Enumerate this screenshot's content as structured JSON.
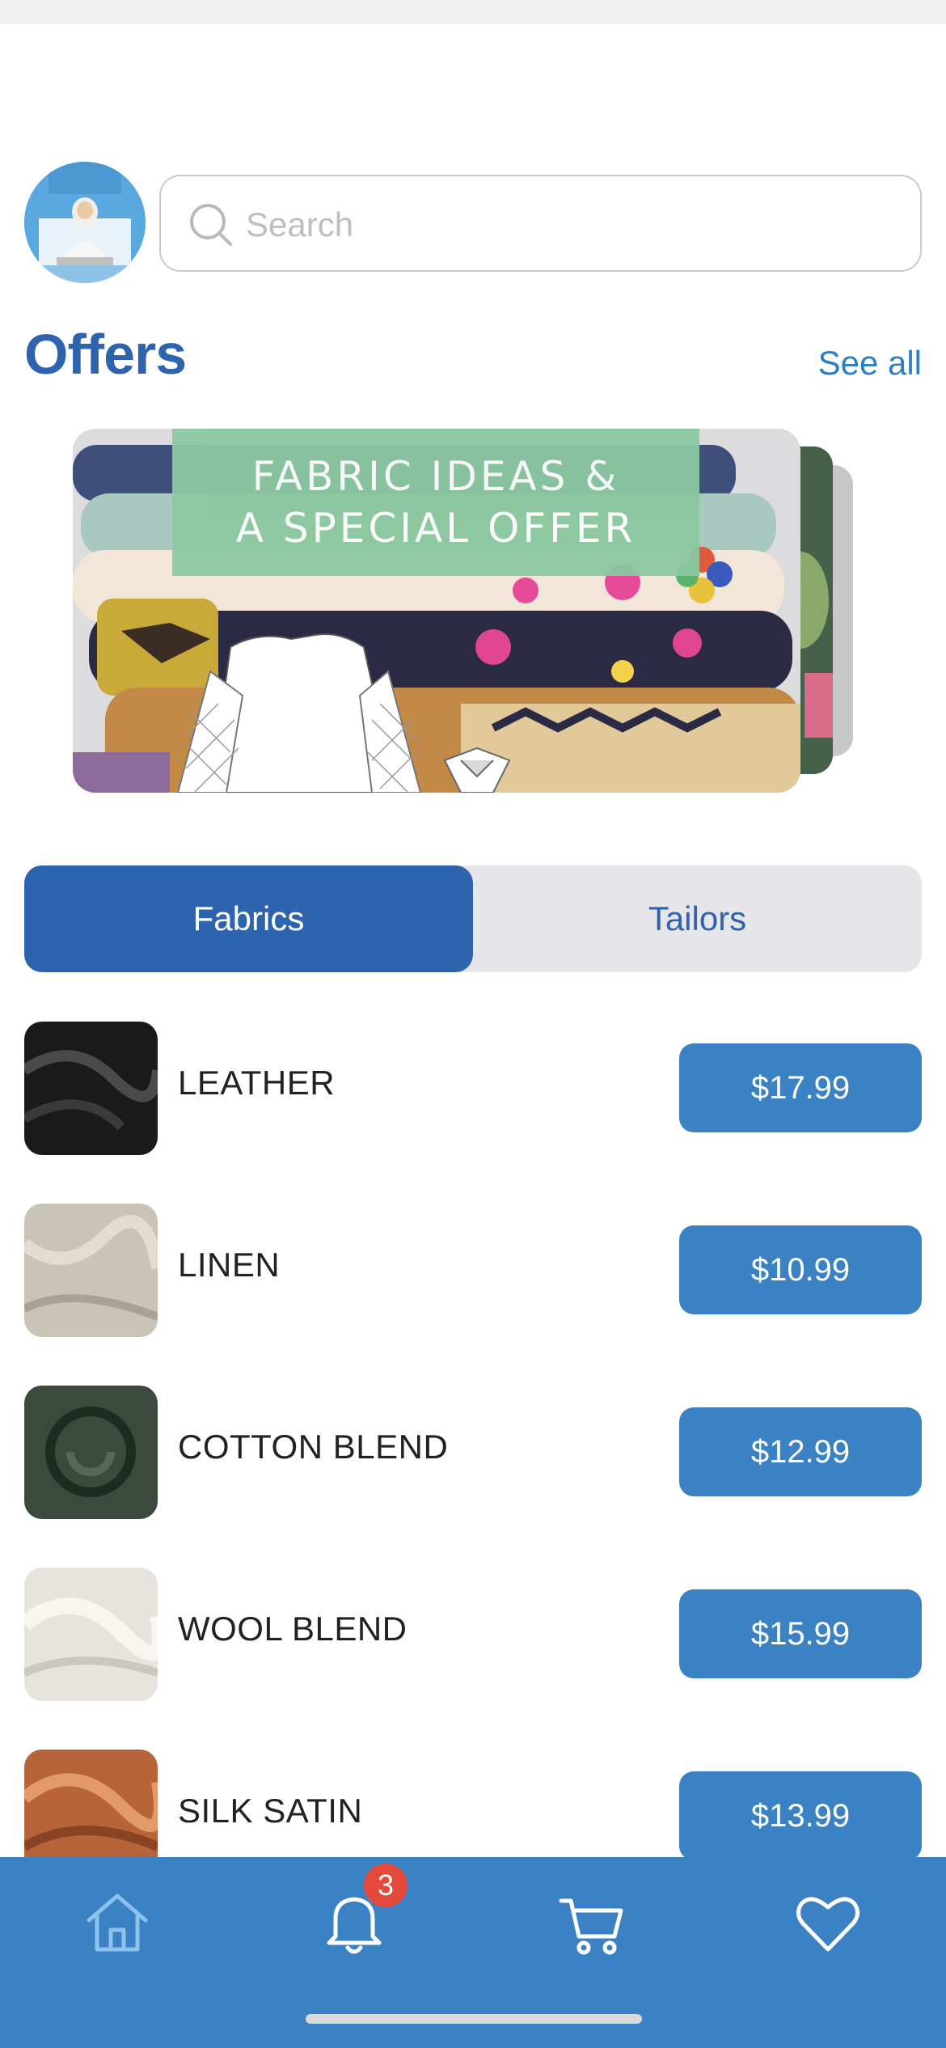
{
  "search": {
    "placeholder": "Search"
  },
  "offers": {
    "title": "Offers",
    "see_all": "See all"
  },
  "banner": {
    "line1": "FABRIC IDEAS &",
    "line2": "A SPECIAL OFFER"
  },
  "segments": {
    "active": "Fabrics",
    "inactive": "Tailors"
  },
  "fabrics": [
    {
      "name": "LEATHER",
      "price": "$17.99",
      "swatch": "#1c1c1c"
    },
    {
      "name": "LINEN",
      "price": "$10.99",
      "swatch": "#c9c4b6"
    },
    {
      "name": "COTTON BLEND",
      "price": "$12.99",
      "swatch": "#3c4a3e"
    },
    {
      "name": "WOOL BLEND",
      "price": "$15.99",
      "swatch": "#e6e4dc"
    },
    {
      "name": "SILK SATIN",
      "price": "$13.99",
      "swatch": "#b8643a"
    }
  ],
  "tabbar": {
    "items": [
      "home-icon",
      "bell-icon",
      "cart-icon",
      "heart-icon"
    ],
    "notification_count": "3"
  },
  "colors": {
    "primary": "#2e63ad",
    "button": "#3a82c4",
    "badge": "#e44a3c"
  }
}
